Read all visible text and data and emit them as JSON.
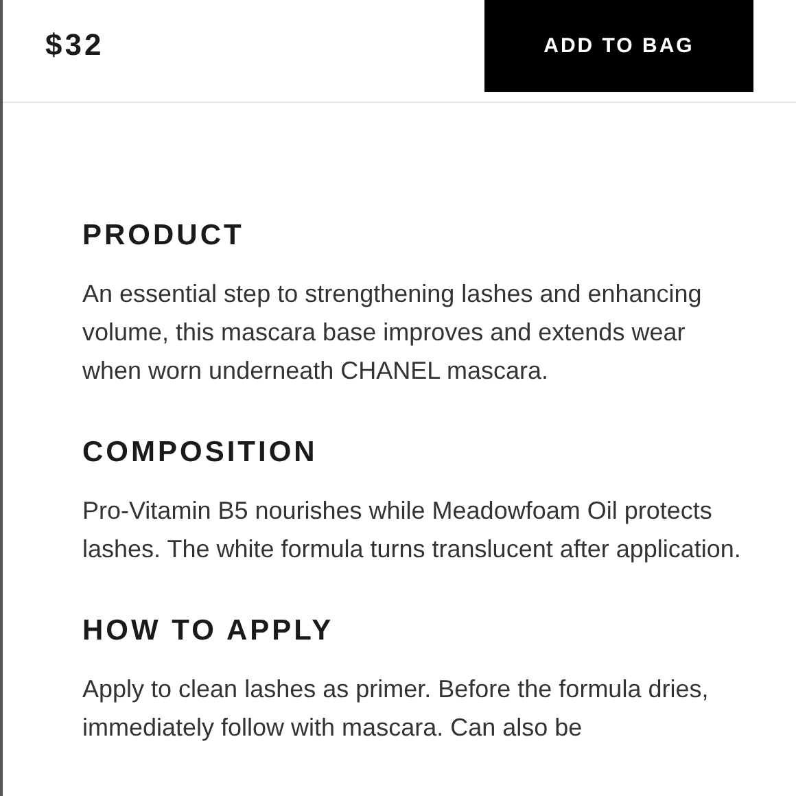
{
  "header": {
    "price": "$32",
    "button": "ADD TO BAG"
  },
  "sections": [
    {
      "heading": "PRODUCT",
      "text": "An essential step to strengthening lashes and enhancing volume, this mascara base improves and extends wear when worn underneath CHANEL mascara."
    },
    {
      "heading": "COMPOSITION",
      "text": "Pro-Vitamin B5 nourishes while Meadowfoam Oil protects lashes. The white formula turns translucent after application."
    },
    {
      "heading": "HOW TO APPLY",
      "text": "Apply to clean lashes as primer. Before the formula dries, immediately follow with mascara. Can also be"
    }
  ]
}
